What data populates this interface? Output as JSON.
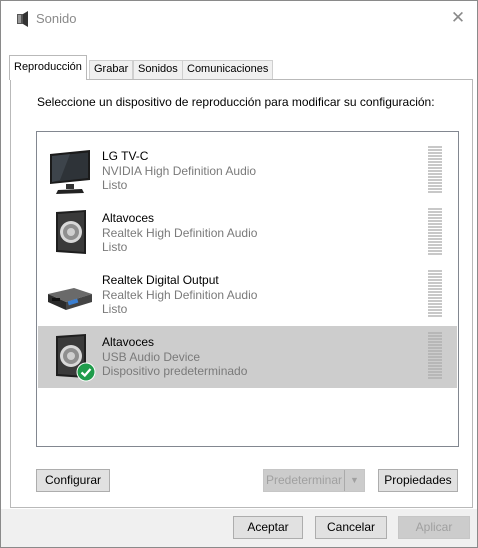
{
  "window": {
    "title": "Sonido",
    "close_glyph": "✕"
  },
  "tabs": [
    {
      "label": "Reproducción",
      "active": true
    },
    {
      "label": "Grabar",
      "active": false
    },
    {
      "label": "Sonidos",
      "active": false
    },
    {
      "label": "Comunicaciones",
      "active": false
    }
  ],
  "instruction": "Seleccione un dispositivo de reproducción para modificar su configuración:",
  "devices": [
    {
      "name": "LG TV-C",
      "driver": "NVIDIA High Definition Audio",
      "status": "Listo",
      "icon": "tv-monitor-icon",
      "selected": false,
      "default": false
    },
    {
      "name": "Altavoces",
      "driver": "Realtek High Definition Audio",
      "status": "Listo",
      "icon": "speaker-icon",
      "selected": false,
      "default": false
    },
    {
      "name": "Realtek Digital Output",
      "driver": "Realtek High Definition Audio",
      "status": "Listo",
      "icon": "digital-output-icon",
      "selected": false,
      "default": false
    },
    {
      "name": "Altavoces",
      "driver": "USB Audio Device",
      "status": "Dispositivo predeterminado",
      "icon": "speaker-icon",
      "selected": true,
      "default": true
    }
  ],
  "buttons": {
    "configure": "Configurar",
    "set_default": "Predeterminar",
    "set_default_arrow": "▼",
    "properties": "Propiedades",
    "ok": "Aceptar",
    "cancel": "Cancelar",
    "apply": "Aplicar"
  },
  "colors": {
    "selected_row": "#cdcdcd",
    "default_check": "#1f9c4b"
  }
}
